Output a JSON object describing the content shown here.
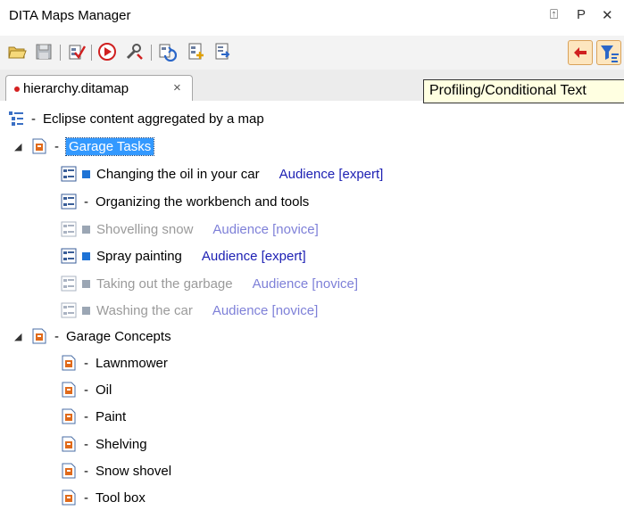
{
  "window": {
    "title": "DITA Maps Manager",
    "restore_glyph": "⍐",
    "pin_glyph": "Ρ",
    "close_glyph": "✕"
  },
  "toolbar": {
    "buttons": [
      "open-folder-icon",
      "save-icon",
      "validate-map-icon",
      "apply-transform-icon",
      "configure-transform-icon",
      "refresh-references-icon",
      "insert-topic-icon",
      "insert-topic-ref-icon"
    ],
    "right_buttons": [
      "show-profiling-icon",
      "profiling-filter-icon"
    ]
  },
  "tabs": [
    {
      "label": "hierarchy.ditamap",
      "close": "×",
      "modified": true
    }
  ],
  "tooltip": {
    "text": "Profiling/Conditional Text"
  },
  "tree": {
    "root": {
      "label": "Eclipse content aggregated by a map"
    },
    "groups": [
      {
        "label": "Garage Tasks",
        "selected": true,
        "children": [
          {
            "label": "Changing the oil in your car",
            "audience": "Audience [expert]",
            "state": "bold"
          },
          {
            "label": "Organizing the workbench and tools",
            "audience": "",
            "state": "normal"
          },
          {
            "label": "Shovelling snow",
            "audience": "Audience [novice]",
            "state": "dim"
          },
          {
            "label": "Spray painting",
            "audience": "Audience [expert]",
            "state": "bold"
          },
          {
            "label": "Taking out the garbage",
            "audience": "Audience [novice]",
            "state": "dim"
          },
          {
            "label": "Washing the car",
            "audience": "Audience [novice]",
            "state": "dim"
          }
        ]
      },
      {
        "label": "Garage Concepts",
        "selected": false,
        "children": [
          {
            "label": "Lawnmower"
          },
          {
            "label": "Oil"
          },
          {
            "label": "Paint"
          },
          {
            "label": "Shelving"
          },
          {
            "label": "Snow shovel"
          },
          {
            "label": "Tool box"
          }
        ]
      }
    ]
  },
  "colors": {
    "accent": "#3399ff",
    "audience": "#1c1fb3",
    "square_active": "#1e73d6",
    "square_dim": "#9ba6b4"
  }
}
